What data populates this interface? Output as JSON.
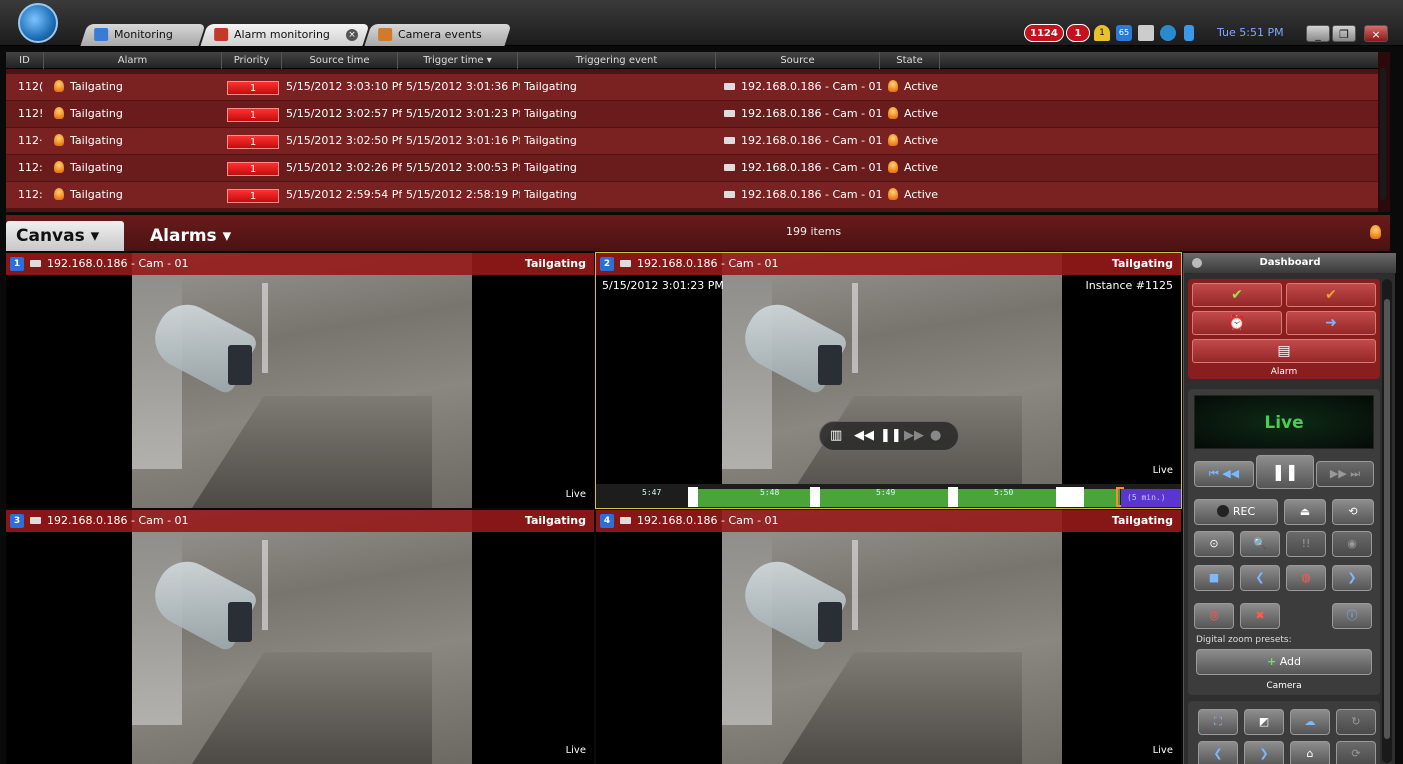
{
  "tabs": [
    {
      "label": "Monitoring"
    },
    {
      "label": "Alarm monitoring"
    },
    {
      "label": "Camera events"
    }
  ],
  "system": {
    "alarm_count": "1124",
    "badge_count": "1",
    "warning_count": "1",
    "monitor_count": "65",
    "clock": "Tue 5:51 PM"
  },
  "alarm_grid": {
    "columns": [
      "ID",
      "Alarm",
      "Priority",
      "Source time",
      "Trigger time",
      "Triggering event",
      "Source",
      "State"
    ],
    "rows": [
      {
        "id": "112(",
        "alarm": "Tailgating",
        "priority": "1",
        "source_time": "5/15/2012 3:03:10 Pf",
        "trigger_time": "5/15/2012 3:01:36 Pf",
        "event": "Tailgating",
        "source": "192.168.0.186 - Cam - 01",
        "state": "Active"
      },
      {
        "id": "112!",
        "alarm": "Tailgating",
        "priority": "1",
        "source_time": "5/15/2012 3:02:57 Pf",
        "trigger_time": "5/15/2012 3:01:23 Pf",
        "event": "Tailgating",
        "source": "192.168.0.186 - Cam - 01",
        "state": "Active"
      },
      {
        "id": "112·",
        "alarm": "Tailgating",
        "priority": "1",
        "source_time": "5/15/2012 3:02:50 Pf",
        "trigger_time": "5/15/2012 3:01:16 Pf",
        "event": "Tailgating",
        "source": "192.168.0.186 - Cam - 01",
        "state": "Active"
      },
      {
        "id": "112:",
        "alarm": "Tailgating",
        "priority": "1",
        "source_time": "5/15/2012 3:02:26 Pf",
        "trigger_time": "5/15/2012 3:00:53 Pf",
        "event": "Tailgating",
        "source": "192.168.0.186 - Cam - 01",
        "state": "Active"
      },
      {
        "id": "112:",
        "alarm": "Tailgating",
        "priority": "1",
        "source_time": "5/15/2012 2:59:54 Pf",
        "trigger_time": "5/15/2012 2:58:19 Pf",
        "event": "Tailgating",
        "source": "192.168.0.186 - Cam - 01",
        "state": "Active"
      }
    ],
    "item_count": "199 items"
  },
  "canvas_tabs": {
    "canvas": "Canvas ▾",
    "alarms": "Alarms ▾"
  },
  "tiles": [
    {
      "num": "1",
      "source": "192.168.0.186 - Cam - 01",
      "event": "Tailgating",
      "status": "Live"
    },
    {
      "num": "2",
      "source": "192.168.0.186 - Cam - 01",
      "event": "Tailgating",
      "status": "Live",
      "timestamp": "5/15/2012 3:01:23 PM",
      "instance": "Instance #1125",
      "timeline": {
        "ticks": [
          "5:47",
          "5:48",
          "5:49",
          "5:50"
        ],
        "window": "(5 min.)"
      }
    },
    {
      "num": "3",
      "source": "192.168.0.186 - Cam - 01",
      "event": "Tailgating",
      "status": "Live"
    },
    {
      "num": "4",
      "source": "192.168.0.186 - Cam - 01",
      "event": "Tailgating",
      "status": "Live"
    }
  ],
  "dashboard": {
    "title": "Dashboard",
    "alarm_label": "Alarm",
    "live_label": "Live",
    "rec_label": "REC",
    "zoom_presets_label": "Digital zoom presets:",
    "add_label": "Add",
    "camera_label": "Camera"
  },
  "colors": {
    "alarm_row": "#7a2222",
    "priority_red": "#e01818",
    "live_green": "#4ccc52",
    "accent_blue": "#2c6fd6"
  }
}
